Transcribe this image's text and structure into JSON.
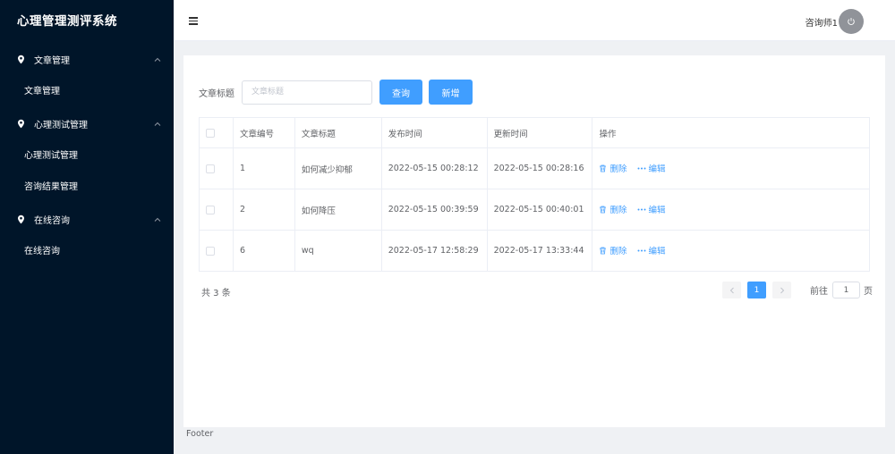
{
  "app": {
    "title": "心理管理测评系统"
  },
  "sidebar": {
    "groups": [
      {
        "label": "文章管理",
        "items": [
          "文章管理"
        ]
      },
      {
        "label": "心理测试管理",
        "items": [
          "心理测试管理",
          "咨询结果管理"
        ]
      },
      {
        "label": "在线咨询",
        "items": [
          "在线咨询"
        ]
      }
    ]
  },
  "header": {
    "user_name": "咨询师1"
  },
  "search": {
    "label": "文章标题",
    "placeholder": "文章标题",
    "query_label": "查询",
    "add_label": "新增"
  },
  "table": {
    "columns": [
      "文章编号",
      "文章标题",
      "发布时间",
      "更新时间",
      "操作"
    ],
    "rows": [
      {
        "id": "1",
        "title": "如何减少抑郁",
        "published": "2022-05-15 00:28:12",
        "updated": "2022-05-15 00:28:16"
      },
      {
        "id": "2",
        "title": "如何降压",
        "published": "2022-05-15 00:39:59",
        "updated": "2022-05-15 00:40:01"
      },
      {
        "id": "6",
        "title": "wq",
        "published": "2022-05-17 12:58:29",
        "updated": "2022-05-17 13:33:44"
      }
    ],
    "delete_label": "删除",
    "edit_label": "编辑"
  },
  "pagination": {
    "total_text": "共 3 条",
    "current_page": "1",
    "goto_prefix": "前往",
    "goto_value": "1",
    "goto_suffix": "页"
  },
  "footer": {
    "text": "Footer"
  },
  "colors": {
    "sidebar_bg": "#001529",
    "accent": "#409eff",
    "page_bg": "#eff1f4"
  }
}
